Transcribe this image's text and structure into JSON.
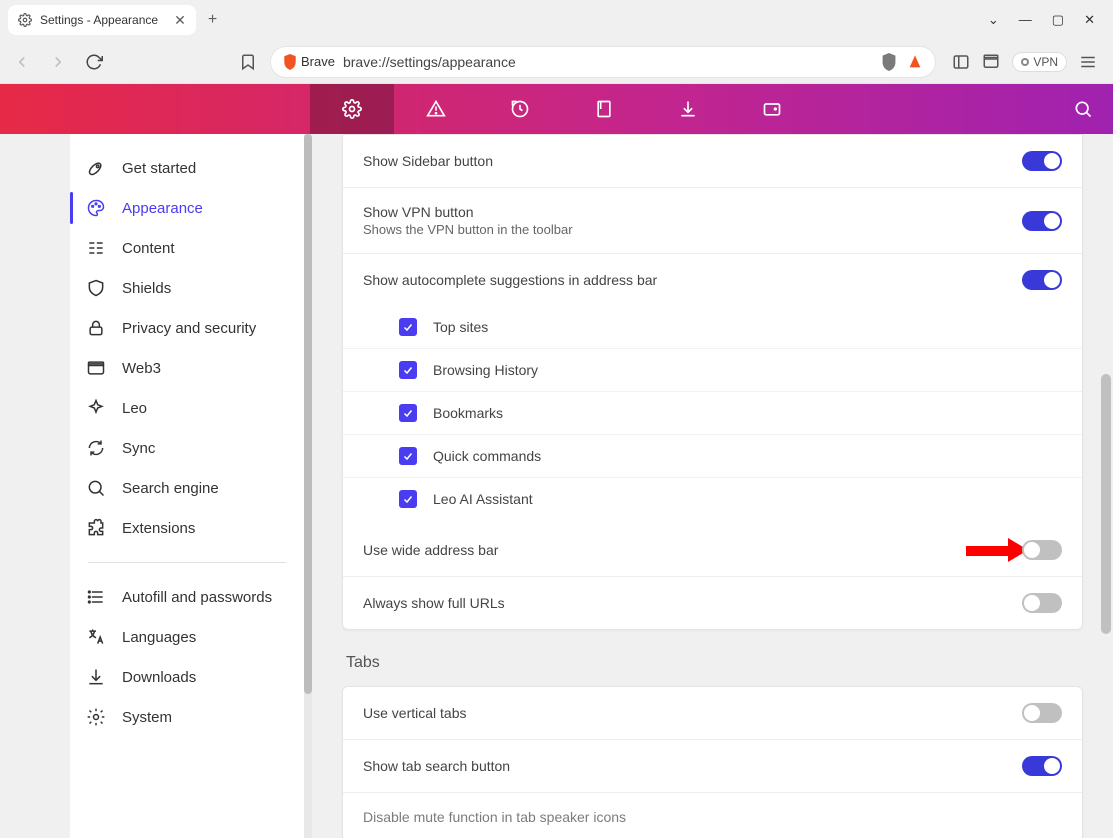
{
  "tab": {
    "title": "Settings - Appearance"
  },
  "addressbar": {
    "brand": "Brave",
    "url": "brave://settings/appearance",
    "vpn": "VPN"
  },
  "sidebar": {
    "primary": [
      {
        "label": "Get started"
      },
      {
        "label": "Appearance"
      },
      {
        "label": "Content"
      },
      {
        "label": "Shields"
      },
      {
        "label": "Privacy and security"
      },
      {
        "label": "Web3"
      },
      {
        "label": "Leo"
      },
      {
        "label": "Sync"
      },
      {
        "label": "Search engine"
      },
      {
        "label": "Extensions"
      }
    ],
    "secondary": [
      {
        "label": "Autofill and passwords"
      },
      {
        "label": "Languages"
      },
      {
        "label": "Downloads"
      },
      {
        "label": "System"
      }
    ]
  },
  "settings": {
    "show_sidebar": "Show Sidebar button",
    "show_vpn": "Show VPN button",
    "show_vpn_sub": "Shows the VPN button in the toolbar",
    "autocomplete": "Show autocomplete suggestions in address bar",
    "autocomplete_items": [
      "Top sites",
      "Browsing History",
      "Bookmarks",
      "Quick commands",
      "Leo AI Assistant"
    ],
    "wide_addr": "Use wide address bar",
    "full_urls": "Always show full URLs",
    "tabs_header": "Tabs",
    "vertical_tabs": "Use vertical tabs",
    "tab_search": "Show tab search button",
    "disable_mute": "Disable mute function in tab speaker icons"
  }
}
